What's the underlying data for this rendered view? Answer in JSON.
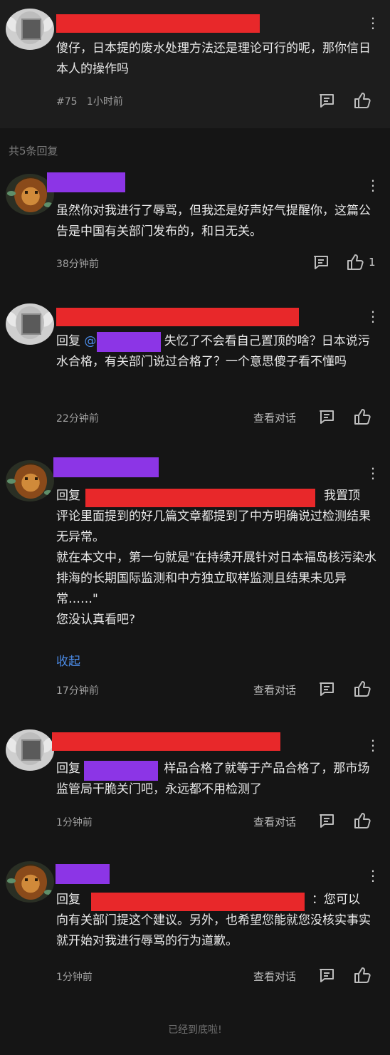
{
  "main": {
    "text": "傻仔，日本提的废水处理方法还是理论可行的呢，那你信日本人的操作吗",
    "floor": "#75",
    "time": "1小时前"
  },
  "replies_label": "共5条回复",
  "replies": [
    {
      "avatar": "lion-avatar",
      "text": "虽然你对我进行了辱骂，但我还是好声好气提醒你，这篇公告是中国有关部门发布的，和日无关。",
      "time": "38分钟前",
      "likes": "1"
    },
    {
      "avatar": "sheep-avatar",
      "reply_prefix": "回复",
      "mention_prefix": "@",
      "text": "失忆了不会看自己置顶的啥？日本说污水合格，有关部门说过合格了？一个意思傻子看不懂吗",
      "time": "22分钟前",
      "view_conversation": "查看对话"
    },
    {
      "avatar": "lion-avatar",
      "reply_prefix": "回复",
      "text_tail": "我置顶",
      "text": "评论里面提到的好几篇文章都提到了中方明确说过检测结果无异常。\n就在本文中，第一句就是\"在持续开展针对日本福岛核污染水排海的长期国际监测和中方独立取样监测且结果未见异常……\"\n您没认真看吧?",
      "collapse": "收起",
      "time": "17分钟前",
      "view_conversation": "查看对话"
    },
    {
      "avatar": "sheep-avatar",
      "reply_prefix": "回复",
      "text": "样品合格了就等于产品合格了，那市场监管局干脆关门吧，永远都不用检测了",
      "time": "1分钟前",
      "view_conversation": "查看对话"
    },
    {
      "avatar": "lion-avatar",
      "reply_prefix": "回复",
      "text_tail": "：您可以",
      "text": "向有关部门提这个建议。另外，也希望您能就您没核实事实就开始对我进行辱骂的行为道歉。",
      "time": "1分钟前",
      "view_conversation": "查看对话"
    }
  ],
  "footer": "已经到底啦!",
  "colors": {
    "redaction_red": "#e8282a",
    "redaction_purple": "#8c35e6",
    "link_blue": "#4b8ce8"
  }
}
